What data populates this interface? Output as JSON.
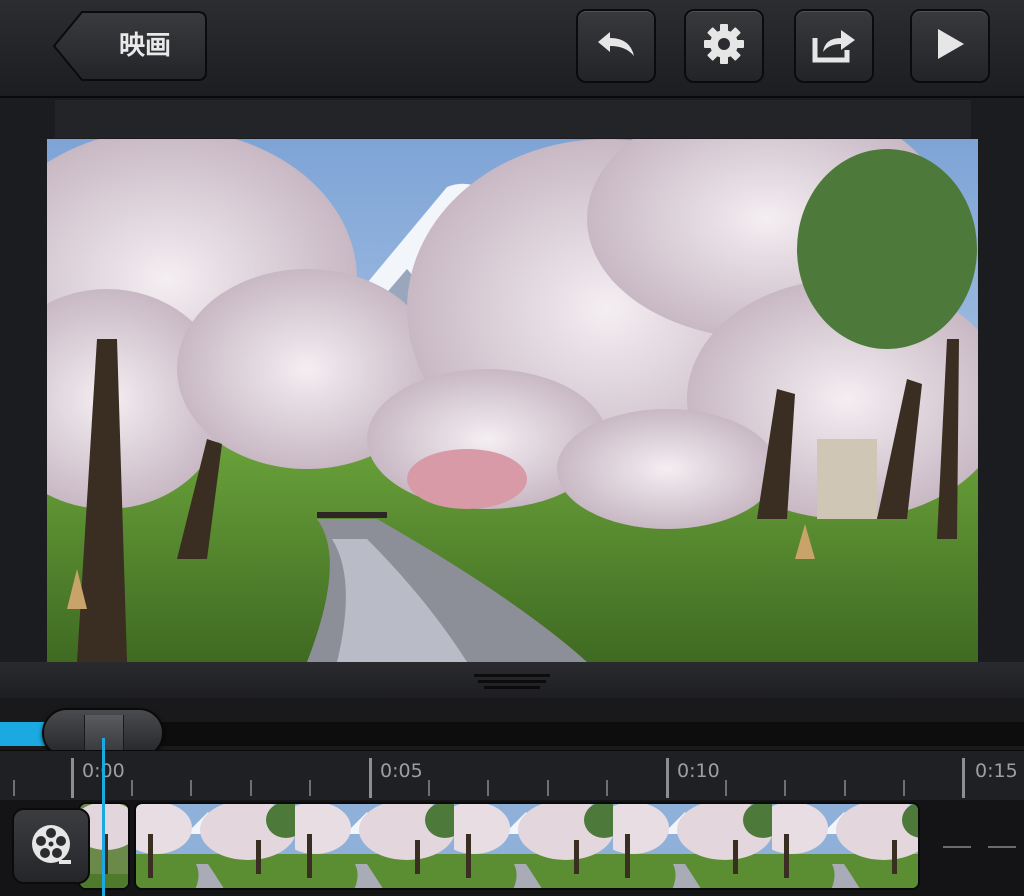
{
  "toolbar": {
    "back_label": "映画",
    "icons": [
      "undo-icon",
      "gear-icon",
      "share-icon",
      "play-icon"
    ]
  },
  "timeline": {
    "ruler_labels": [
      "0:00",
      "0:05",
      "0:10",
      "0:15"
    ]
  },
  "colors": {
    "accent": "#1aa9e1",
    "toolbar_bg": "#2c2d30"
  }
}
